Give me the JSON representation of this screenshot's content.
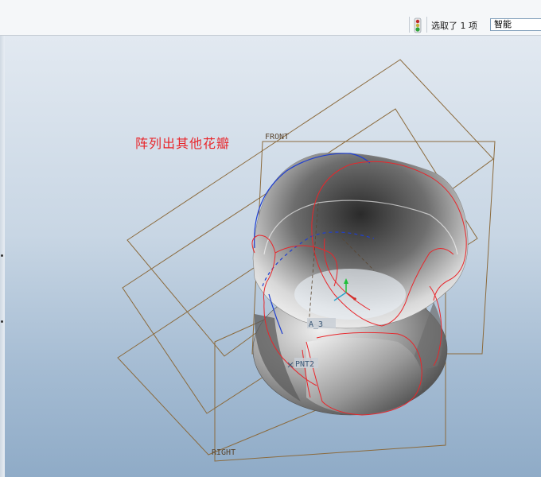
{
  "status_bar": {
    "selection_text": "选取了 1 项",
    "filter_value": "智能"
  },
  "viewport": {
    "annotation": "阵列出其他花瓣",
    "datum_planes": {
      "front": "FRONT",
      "right": "RIGHT"
    },
    "datum_axes": {
      "a3": "A_3",
      "pnt": "PNT2"
    }
  },
  "colors": {
    "annotation": "#e8262b",
    "datum_plane": "#8b6a3c",
    "petal_edge": "#e8262b",
    "sketch_curve": "#1f3fd0"
  }
}
